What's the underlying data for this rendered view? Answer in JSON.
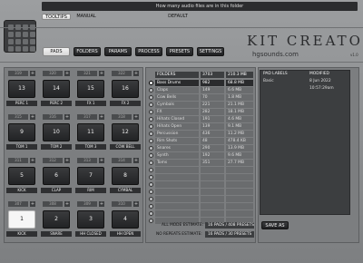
{
  "header": {
    "info": "How many audio files are in this folder",
    "tooltips_label": "TOOLTIPS",
    "manual_label": "MANUAL",
    "default_label": "DEFAULT",
    "title": "KIT CREATOR",
    "subtitle": "hgsounds.com",
    "version": "v1.0"
  },
  "tabs": [
    "PADS",
    "FOLDERS",
    "PARAMS",
    "PROCESS",
    "PRESETS",
    "SETTINGS"
  ],
  "pads": {
    "rows": [
      [
        {
          "num": "13",
          "label": "PERC 1",
          "idx": "319"
        },
        {
          "num": "14",
          "label": "PERC 2",
          "idx": "320"
        },
        {
          "num": "15",
          "label": "FX 1",
          "idx": "321"
        },
        {
          "num": "16",
          "label": "FX 2",
          "idx": "322"
        }
      ],
      [
        {
          "num": "9",
          "label": "TOM 1",
          "idx": "315"
        },
        {
          "num": "10",
          "label": "TOM 2",
          "idx": "316"
        },
        {
          "num": "11",
          "label": "TOM 3",
          "idx": "317"
        },
        {
          "num": "12",
          "label": "COW BELL",
          "idx": "318"
        }
      ],
      [
        {
          "num": "5",
          "label": "KICK",
          "idx": "311"
        },
        {
          "num": "6",
          "label": "CLAP",
          "idx": "312"
        },
        {
          "num": "7",
          "label": "RIM",
          "idx": "313"
        },
        {
          "num": "8",
          "label": "CYMBAL",
          "idx": "314"
        }
      ],
      [
        {
          "num": "1",
          "label": "KICK",
          "idx": "307"
        },
        {
          "num": "2",
          "label": "SNARE",
          "idx": "308"
        },
        {
          "num": "3",
          "label": "HH CLOSED",
          "idx": "309"
        },
        {
          "num": "4",
          "label": "HH OPEN",
          "idx": "310"
        }
      ]
    ],
    "selected": "1"
  },
  "folders": {
    "header": {
      "name": "FOLDERS",
      "count": "3703",
      "size": "210.3 MB"
    },
    "rows": [
      {
        "name": "Bass Drums",
        "count": "982",
        "size": "68.8 MB",
        "selected": true
      },
      {
        "name": "Claps",
        "count": "149",
        "size": "6.6 MB"
      },
      {
        "name": "Cow Bells",
        "count": "70",
        "size": "1.8 MB"
      },
      {
        "name": "Cymbals",
        "count": "221",
        "size": "21.1 MB"
      },
      {
        "name": "FX",
        "count": "282",
        "size": "18.1 MB"
      },
      {
        "name": "Hihats Closed",
        "count": "191",
        "size": "4.6 MB"
      },
      {
        "name": "Hihats Open",
        "count": "139",
        "size": "9.1 MB"
      },
      {
        "name": "Percussion",
        "count": "436",
        "size": "11.2 MB"
      },
      {
        "name": "Rim Shots",
        "count": "48",
        "size": "478.4 KB"
      },
      {
        "name": "Snares",
        "count": "290",
        "size": "13.9 MB"
      },
      {
        "name": "Synth",
        "count": "192",
        "size": "9.6 MB"
      },
      {
        "name": "Toms",
        "count": "351",
        "size": "27.7 MB"
      }
    ],
    "empty_rows": 8
  },
  "estimates": {
    "all_mode_label": "ALL MODE ESTIMATE:",
    "all_mode_value": "16 PADS / 408 PRESETS",
    "no_repeats_label": "NO REPEATS ESTIMATE:",
    "no_repeats_value": "16 PADS / 30 PRESETS"
  },
  "pad_labels": {
    "col1": "PAD LABELS",
    "col2": "MODIFIED",
    "rows": [
      {
        "name": "Basic",
        "modified": "8 Jun 2022 10:57:29am"
      }
    ],
    "save_label": "SAVE AS"
  },
  "colors": {
    "accent": "#f4f4f4",
    "dark": "#2b2c2e",
    "panel": "#7c7e80"
  }
}
